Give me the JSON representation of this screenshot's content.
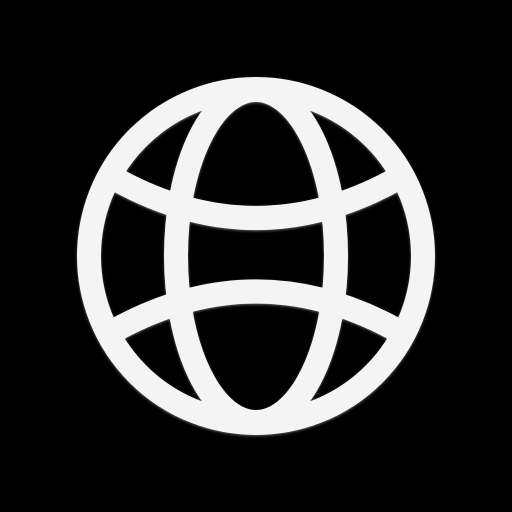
{
  "icon": {
    "name": "globe-icon",
    "background_color": "#000000",
    "stroke_color": "#f4f4f4",
    "shadow_color": "#9a9a9a"
  }
}
